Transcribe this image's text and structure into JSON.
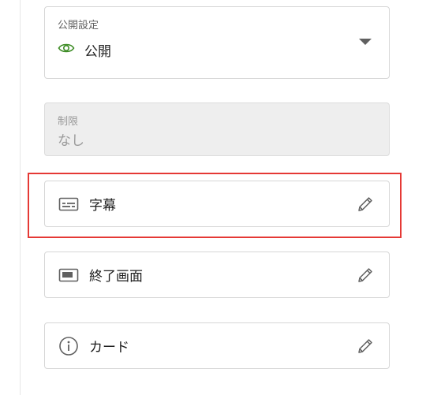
{
  "visibility": {
    "label": "公開設定",
    "value": "公開",
    "icon": "eye-icon",
    "icon_color": "#3d8c25"
  },
  "restriction": {
    "label": "制限",
    "value": "なし"
  },
  "rows": {
    "subtitles": {
      "label": "字幕",
      "icon": "subtitles-icon"
    },
    "end_screen": {
      "label": "終了画面",
      "icon": "end-screen-icon"
    },
    "cards": {
      "label": "カード",
      "icon": "info-icon"
    }
  },
  "highlight_color": "#e53935",
  "edit_icon": "pencil-icon"
}
